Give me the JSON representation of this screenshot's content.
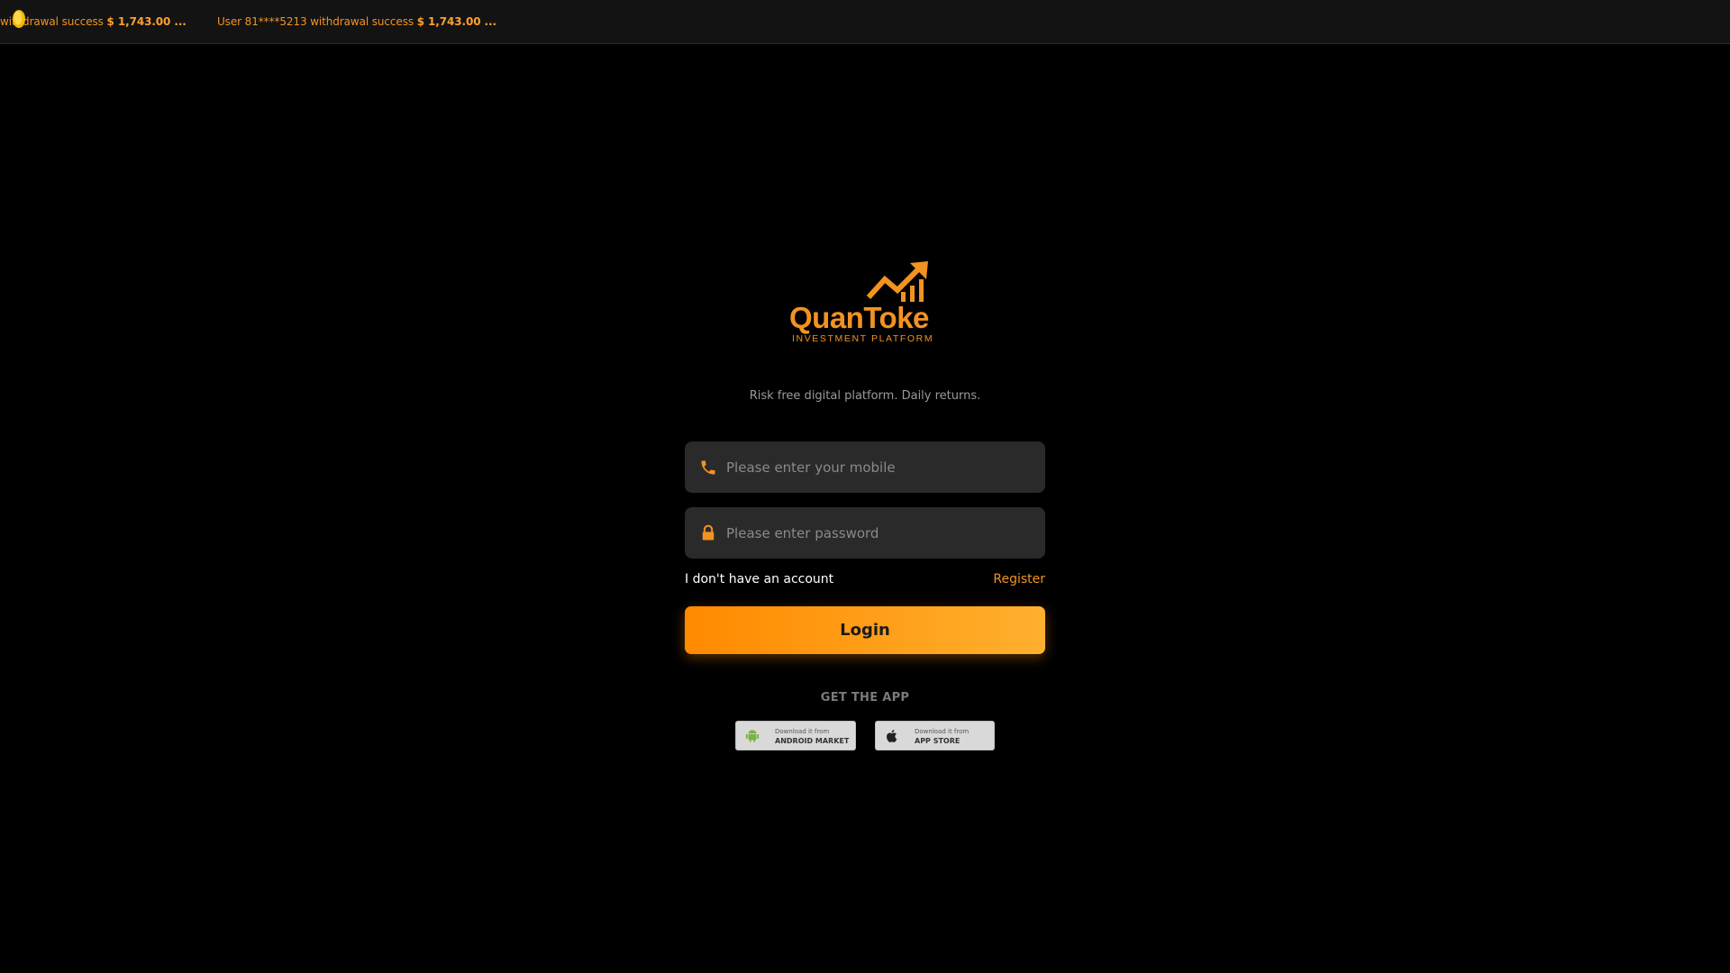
{
  "ticker": {
    "items": [
      {
        "text": "withdrawal success ",
        "amount": "$ 1,743.00 ..."
      },
      {
        "text": "User 81****5213 withdrawal success ",
        "amount": "$ 1,743.00 ..."
      }
    ]
  },
  "brand": {
    "name": "QuanToke",
    "subtitle": "INVESTMENT PLATFORM",
    "accent_color": "#f29320",
    "tagline": "Risk free digital platform. Daily returns."
  },
  "form": {
    "mobile_placeholder": "Please enter your mobile",
    "mobile_icon": "phone-icon",
    "password_placeholder": "Please enter password",
    "password_icon": "lock-icon",
    "no_account_text": "I don't have an account",
    "register_label": "Register",
    "login_label": "Login"
  },
  "app": {
    "heading": "GET THE APP",
    "android": {
      "line1": "Download it from",
      "line2": "ANDROID MARKET",
      "icon": "android-icon"
    },
    "apple": {
      "line1": "Download it from",
      "line2": "APP STORE",
      "icon": "apple-icon"
    }
  }
}
